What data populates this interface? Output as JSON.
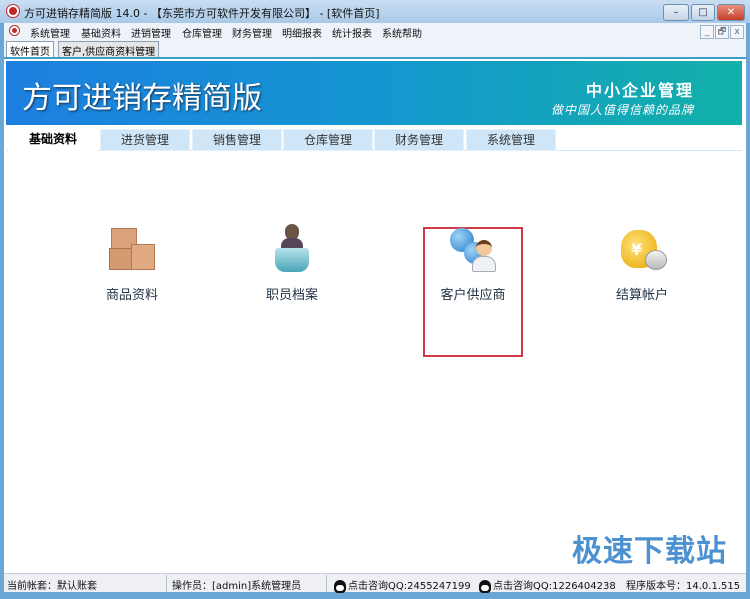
{
  "window": {
    "title": "方可进销存精简版 14.0 - 【东莞市方可软件开发有限公司】 - [软件首页]",
    "minimize": "–",
    "maximize": "□",
    "close": "✕"
  },
  "menu": {
    "items": [
      "系统管理",
      "基础资料",
      "进销管理",
      "仓库管理",
      "财务管理",
      "明细报表",
      "统计报表",
      "系统帮助"
    ],
    "mdi": [
      "_",
      "🗗",
      "x"
    ]
  },
  "doc_tabs": [
    {
      "label": "软件首页",
      "active": true
    },
    {
      "label": "客户,供应商资料管理",
      "active": false
    }
  ],
  "banner": {
    "title": "方可进销存精简版",
    "right_title": "中小企业管理",
    "slogan": "做中国人值得信赖的品牌"
  },
  "tabs": [
    {
      "label": "基础资料",
      "active": true
    },
    {
      "label": "进货管理"
    },
    {
      "label": "销售管理"
    },
    {
      "label": "仓库管理"
    },
    {
      "label": "财务管理"
    },
    {
      "label": "系统管理"
    }
  ],
  "tiles": [
    {
      "label": "商品资料",
      "icon": "boxes-icon"
    },
    {
      "label": "职员档案",
      "icon": "staff-icon"
    },
    {
      "label": "客户供应商",
      "icon": "customer-supplier-icon",
      "selected": true
    },
    {
      "label": "结算帐户",
      "icon": "money-bag-icon"
    }
  ],
  "status": {
    "account": "当前帐套：默认账套",
    "operator": "操作员：[admin]系统管理员",
    "qq1": "点击咨询QQ:2455247199",
    "qq2": "点击咨询QQ:1226404238",
    "version": "程序版本号：14.0.1.515"
  },
  "watermark": "极速下载站",
  "colors": {
    "selection": "#d03a44",
    "banner_start": "#1d7fe0",
    "banner_end": "#12b0a8"
  }
}
